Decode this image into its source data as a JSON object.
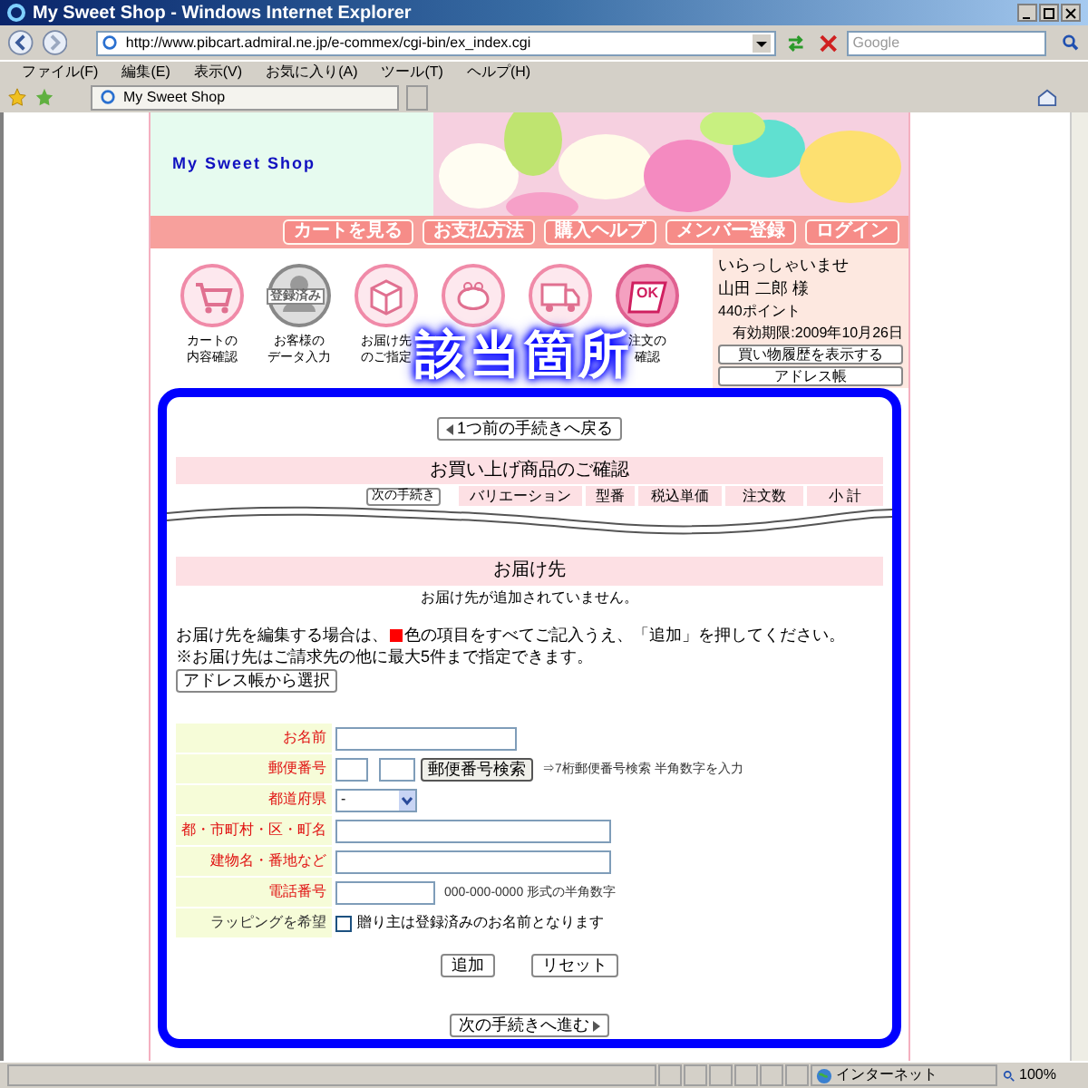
{
  "window": {
    "title": "My Sweet Shop - Windows Internet Explorer"
  },
  "toolbar": {
    "address": "http://www.pibcart.admiral.ne.jp/e-commex/cgi-bin/ex_index.cgi",
    "search_placeholder": "Google"
  },
  "menu": [
    "ファイル(F)",
    "編集(E)",
    "表示(V)",
    "お気に入り(A)",
    "ツール(T)",
    "ヘルプ(H)"
  ],
  "tab": {
    "label": "My Sweet Shop"
  },
  "shop": {
    "logo": "My Sweet Shop",
    "nav": [
      "カートを見る",
      "お支払方法",
      "購入ヘルプ",
      "メンバー登録",
      "ログイン"
    ],
    "steps": [
      {
        "kind": "cart",
        "label": [
          "カートの",
          "内容確認"
        ],
        "selected": false
      },
      {
        "kind": "person",
        "label": [
          "お客様の",
          "データ入力"
        ],
        "badge": "登録済み",
        "selected": false
      },
      {
        "kind": "box",
        "label": [
          "お届け先",
          "のご指定"
        ],
        "selected": false
      },
      {
        "kind": "purse",
        "selected": false
      },
      {
        "kind": "truck",
        "selected": false
      },
      {
        "kind": "ok",
        "mark": "OK",
        "label": [
          "注文の",
          "確認"
        ],
        "selected": true
      }
    ],
    "member": {
      "greeting": "いらっしゃいませ",
      "name": "山田 二郎 様",
      "points": "440ポイント",
      "expiry": "有効期限:2009年10月26日",
      "buttons": [
        "買い物履歴を表示する",
        "アドレス帳"
      ]
    }
  },
  "annotation": {
    "label": "該当箇所"
  },
  "back_button": "1つ前の手続きへ戻る",
  "cart": {
    "title": "お買い上げ商品のご確認",
    "partial_button": "次の手続き",
    "columns": [
      "バリエーション",
      "型番",
      "税込単価",
      "注文数",
      "小 計"
    ]
  },
  "delivery": {
    "title": "お届け先",
    "empty": "お届け先が追加されていません。",
    "instruction_before": "お届け先を編集する場合は、",
    "instruction_after": "色の項目をすべてご記入うえ、「追加」を押してください。",
    "note": "※お届け先はご請求先の他に最大5件まで指定できます。",
    "address_book_button": "アドレス帳から選択",
    "fields": [
      {
        "kind": "shorttext",
        "label": "お名前",
        "required": true
      },
      {
        "kind": "zip",
        "label": "郵便番号",
        "required": true,
        "button": "郵便番号検索",
        "hint": "⇒7桁郵便番号検索 半角数字を入力"
      },
      {
        "kind": "select",
        "label": "都道府県",
        "required": true,
        "value": "-"
      },
      {
        "kind": "longtext",
        "label": "都・市町村・区・町名",
        "required": true
      },
      {
        "kind": "longtext",
        "label": "建物名・番地など",
        "required": true
      },
      {
        "kind": "phonetext",
        "label": "電話番号",
        "required": true,
        "hint": "000-000-0000 形式の半角数字"
      },
      {
        "kind": "checkbox",
        "label": "ラッピングを希望",
        "required": false,
        "checked": false,
        "text": "贈り主は登録済みのお名前となります"
      }
    ],
    "buttons": [
      "追加",
      "リセット"
    ]
  },
  "next_button": "次の手続きへ進む",
  "status_bar": {
    "zone": "インターネット",
    "zoom": "100%"
  }
}
